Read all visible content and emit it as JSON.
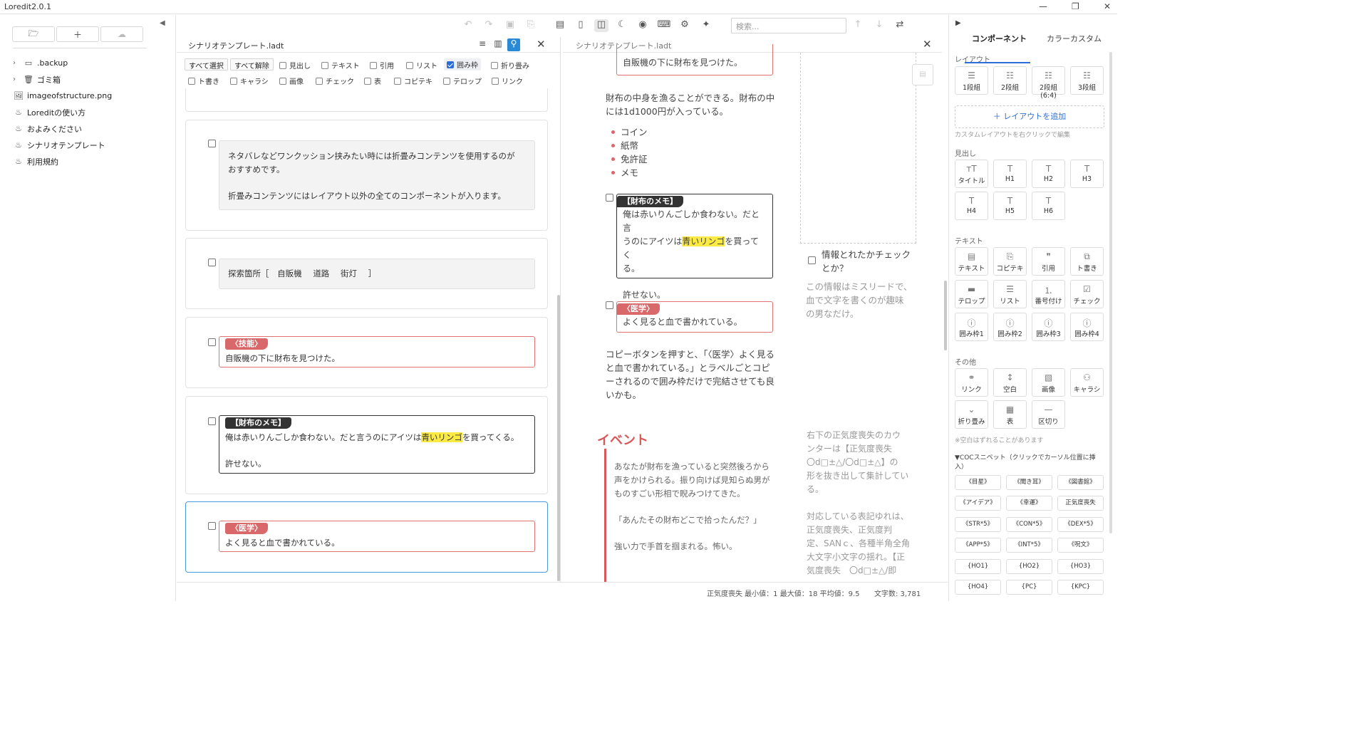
{
  "app": {
    "title": "Loredit2.0.1"
  },
  "sidebar": {
    "items": [
      {
        "label": ".backup",
        "icon": "folder-icon",
        "expandable": true
      },
      {
        "label": "ゴミ箱",
        "icon": "trash-icon",
        "expandable": true
      },
      {
        "label": "imageofstructure.png",
        "icon": "image-icon",
        "expandable": false
      },
      {
        "label": "Loreditの使い方",
        "icon": "doc-icon",
        "expandable": false
      },
      {
        "label": "およみください",
        "icon": "doc-icon",
        "expandable": false
      },
      {
        "label": "シナリオテンプレート",
        "icon": "doc-icon",
        "expandable": false
      },
      {
        "label": "利用規約",
        "icon": "doc-icon",
        "expandable": false
      }
    ]
  },
  "toolbar": {
    "search_placeholder": "検索..."
  },
  "editor": {
    "filename": "シナリオテンプレート.ladt",
    "select_all": "すべて選択",
    "deselect_all": "すべて解除",
    "filters_row1": [
      "見出し",
      "テキスト",
      "引用",
      "リスト",
      "囲み枠",
      "折り畳み"
    ],
    "filters_row2": [
      "ト書き",
      "キャラシ",
      "画像",
      "チェック",
      "表",
      "コピテキ",
      "テロップ",
      "リンク"
    ],
    "active_filter": "囲み枠",
    "card_fold": {
      "line1": "ネタバレなどワンクッション挟みたい時には折畳みコンテンツを使用するのが",
      "line2": "おすすめです。",
      "line3": "折畳みコンテンツにはレイアウト以外の全てのコンポーネントが入ります。"
    },
    "card_search": {
      "label": "探索箇所［",
      "items": [
        "自販機",
        "道路",
        "街灯"
      ],
      "close": "］"
    },
    "card_skill": {
      "tag": "〈技能〉",
      "text": "自販機の下に財布を見つけた。"
    },
    "card_memo": {
      "tag": "【財布のメモ】",
      "pre": "俺は赤いりんごしか食わない。だと言うのにアイツは",
      "highlight": "青いリンゴ",
      "post": "を買ってくる。",
      "line2": "許せない。"
    },
    "card_med": {
      "tag": "〈医学〉",
      "text": "よく見ると血で書かれている。"
    }
  },
  "preview": {
    "filename": "シナリオテンプレート.ladt",
    "top_box": "自販機の下に財布を見つけた。",
    "para1a": "財布の中身を漁ることができる。財布の中",
    "para1b": "には1d1000円が入っている。",
    "bullets": [
      "コイン",
      "紙幣",
      "免許証",
      "メモ"
    ],
    "memo_tag": "【財布のメモ】",
    "memo_l1": "俺は赤いりんごしか食わない。だと言",
    "memo_l2a": "うのにアイツは",
    "memo_hl": "青いリンゴ",
    "memo_l2b": "を買ってく",
    "memo_l3": "る。",
    "memo_l4": "許せない。",
    "side_check_l1": "情報とれたかチェック",
    "side_check_l2": "とか？",
    "side_note": [
      "この情報はミスリードで、",
      "血で文字を書くのが趣味",
      "の男なだけ。"
    ],
    "med_tag": "〈医学〉",
    "med_text": "よく見ると血で書かれている。",
    "copy_para": [
      "コピーボタンを押すと、「〈医学〉よく見る",
      "と血で書かれている。」とラベルごとコピ",
      "ーされるので囲み枠だけで完結させても良",
      "いかも。"
    ],
    "event_heading": "イベント",
    "event_text": [
      "あなたが財布を漁っていると突然後ろから",
      "声をかけられる。振り向けば見知らぬ男が",
      "ものすごい形相で睨みつけてきた。",
      "",
      "「あんたその財布どこで拾ったんだ？」",
      "",
      "強い力で手首を掴まれる。怖い。"
    ],
    "event_note": [
      "右下の正気度喪失のカウ",
      "ンターは【正気度喪失",
      "〇d□±△/〇d□±△】の",
      "形を抜き出して集計してい",
      "る。",
      "",
      "対応している表記ゆれは、",
      "正気度喪失、正気度判",
      "定、SANｃ、各種半角全角",
      "大文字小文字の揺れ。【正",
      "気度喪失　〇d□±△/即"
    ]
  },
  "status": {
    "san": "正気度喪失 最小値：1 最大値：18 平均値：9.5",
    "chars": "文字数: 3,781"
  },
  "rpanel": {
    "tabs": [
      "コンポーネント",
      "カラーカスタム"
    ],
    "layout_title": "レイアウト",
    "layouts": [
      "1段組",
      "2段組",
      "2段組(6:4)",
      "3段組"
    ],
    "add_layout": "レイアウトを追加",
    "layout_hint": "カスタムレイアウトを右クリックで編集",
    "heading_title": "見出し",
    "headings": [
      "タイトル",
      "H1",
      "H2",
      "H3",
      "H4",
      "H5",
      "H6"
    ],
    "text_title": "テキスト",
    "texts": [
      "テキスト",
      "コピテキ",
      "引用",
      "ト書き",
      "テロップ",
      "リスト",
      "番号付け",
      "チェック",
      "囲み枠1",
      "囲み枠2",
      "囲み枠3",
      "囲み枠4"
    ],
    "other_title": "その他",
    "others": [
      "リンク",
      "空白",
      "画像",
      "キャラシ",
      "折り畳み",
      "表",
      "区切り"
    ],
    "space_note": "※空白はずれることがあります",
    "snippet_title": "▼COCスニペット（クリックでカーソル位置に挿",
    "snippet_title2": "入）",
    "snippets": [
      "《目星》",
      "《聞き耳》",
      "《図書館》",
      "《アイデア》",
      "《幸運》",
      "正気度喪失",
      "《STR*5》",
      "《CON*5》",
      "《DEX*5》",
      "《APP*5》",
      "《INT*5》",
      "《呪文》",
      "{HO1}",
      "{HO2}",
      "{HO3}",
      "{HO4}",
      "{PC}",
      "{KPC}"
    ]
  }
}
